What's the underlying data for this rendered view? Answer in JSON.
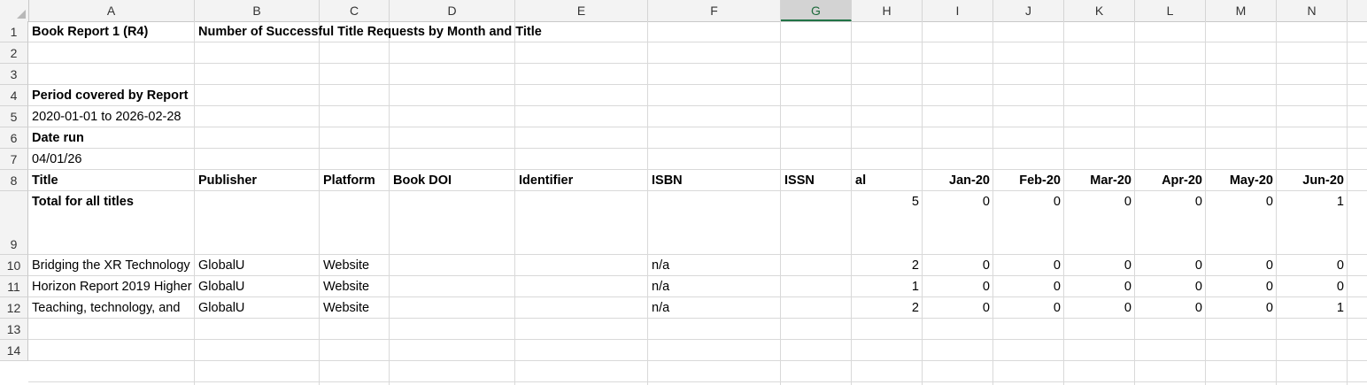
{
  "columns": [
    "A",
    "B",
    "C",
    "D",
    "E",
    "F",
    "G",
    "H",
    "I",
    "J",
    "K",
    "L",
    "M",
    "N"
  ],
  "rows": [
    "1",
    "2",
    "3",
    "4",
    "5",
    "6",
    "7",
    "8",
    "9",
    "10",
    "11",
    "12",
    "13",
    "14"
  ],
  "report": {
    "name": "Book Report 1 (R4)",
    "description": "Number of Successful Title Requests by Month and Title",
    "period_label": "Period covered by Report",
    "period_value": "2020-01-01 to 2026-02-28",
    "date_run_label": "Date run",
    "date_run_value": "04/01/26"
  },
  "table": {
    "headers": {
      "title": "Title",
      "publisher": "Publisher",
      "platform": "Platform",
      "doi": "Book DOI",
      "proprietary": "Proprietary Identifier",
      "isbn": "ISBN",
      "issn": "ISSN",
      "total": "Reporting Period Total",
      "months": [
        "Jan-20",
        "Feb-20",
        "Mar-20",
        "Apr-20",
        "May-20",
        "Jun-20"
      ]
    },
    "total_row": {
      "label": "Total for all titles",
      "total": "5",
      "months": [
        "0",
        "0",
        "0",
        "0",
        "0",
        "1"
      ]
    },
    "rows": [
      {
        "title": "Bridging the XR Technology",
        "publisher": "GlobalU",
        "platform": "Website",
        "isbn": "n/a",
        "total": "2",
        "months": [
          "0",
          "0",
          "0",
          "0",
          "0",
          "0"
        ]
      },
      {
        "title": "Horizon Report 2019 Higher",
        "publisher": "GlobalU",
        "platform": "Website",
        "isbn": "n/a",
        "total": "1",
        "months": [
          "0",
          "0",
          "0",
          "0",
          "0",
          "0"
        ]
      },
      {
        "title": "Teaching, technology, and",
        "publisher": "GlobalU",
        "platform": "Website",
        "isbn": "n/a",
        "total": "2",
        "months": [
          "0",
          "0",
          "0",
          "0",
          "0",
          "1"
        ]
      }
    ]
  }
}
